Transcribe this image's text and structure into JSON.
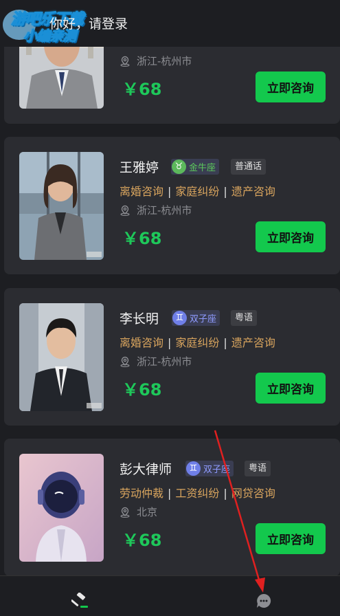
{
  "header": {
    "watermark_line1": "游吧乐下载",
    "watermark_line2": "小编亲测",
    "greeting": "你好，请登录"
  },
  "lawyers": [
    {
      "name": "",
      "zodiac": "",
      "language": "",
      "specialties": [],
      "location": "浙江-杭州市",
      "price": "￥68",
      "consult_label": "立即咨询"
    },
    {
      "name": "王雅婷",
      "zodiac": "金牛座",
      "zodiac_symbol": "♉",
      "zodiac_color": "#5cb85c",
      "language": "普通话",
      "specialties": [
        "离婚咨询",
        "家庭纠纷",
        "遗产咨询"
      ],
      "location": "浙江-杭州市",
      "price": "￥68",
      "consult_label": "立即咨询"
    },
    {
      "name": "李长明",
      "zodiac": "双子座",
      "zodiac_symbol": "♊",
      "zodiac_color": "#6f7fe8",
      "language": "粤语",
      "specialties": [
        "离婚咨询",
        "家庭纠纷",
        "遗产咨询"
      ],
      "location": "浙江-杭州市",
      "price": "￥68",
      "consult_label": "立即咨询"
    },
    {
      "name": "彭大律师",
      "zodiac": "双子座",
      "zodiac_symbol": "♊",
      "zodiac_color": "#6f7fe8",
      "language": "粤语",
      "specialties": [
        "劳动仲裁",
        "工资纠纷",
        "网贷咨询"
      ],
      "location": "北京",
      "price": "￥68",
      "consult_label": "立即咨询"
    }
  ],
  "tabbar": {
    "tabs": [
      {
        "icon": "gavel-icon",
        "active": true
      },
      {
        "icon": "chat-bubble-icon",
        "active": false
      }
    ]
  },
  "colors": {
    "accent_green": "#13c84d",
    "price_green": "#1ec85a",
    "tag_gold": "#d9a55e",
    "annotation_red": "#e02020"
  }
}
